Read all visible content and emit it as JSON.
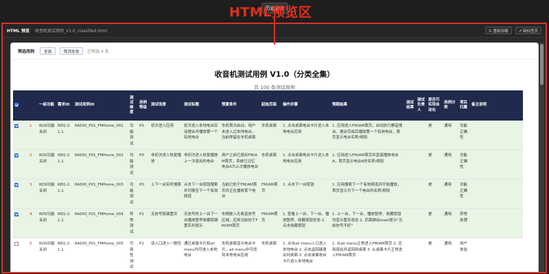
{
  "top": {
    "history_button": "历史记录"
  },
  "preview": {
    "title": "HTML 预览",
    "filename": "收音机测试用例_V1.0_classified.html",
    "reload_button": "↻ 重新加载",
    "new_tab_button": "↗ 新标签页",
    "overlay_title": "HTML预览区"
  },
  "toolbar": {
    "label": "筛选用例",
    "select_all": "全选",
    "deselect_all": "取消全选",
    "status": "已筛选 4 条"
  },
  "doc": {
    "title": "收音机测试用例 V1.0（分类全集）",
    "subtitle": "共 100 条测试用例"
  },
  "table": {
    "headers": [
      "",
      "",
      "一级功能",
      "需求ID",
      "测试用例ID",
      "测试维度",
      "用例等级",
      "测试场景",
      "测试标题",
      "预置条件",
      "起始页面",
      "操作步骤",
      "预期结果",
      "测试结果",
      "测试负责人",
      "是否可实现自动化",
      "用例分类",
      "项目归属",
      "备注说明"
    ],
    "rows": [
      {
        "checked": true,
        "num": "1",
        "func": "RDS功能关闭",
        "req": "REQ-2.1.1",
        "id": "RADIO_P01_FMHome_001",
        "dim": "功能测试",
        "level": "P0",
        "scene": "初次进入应用",
        "title": "初次进入本地电台后动搜台并播放第一个有效电台",
        "pre": "车机首次启动，用户未进入过本地电台，当前停留在车机桌面",
        "start": "车机桌面",
        "steps": "1. 点击桌面电台卡片进入本地电台应用",
        "expect": "1. 应用进入FM/AM首页，自动执行静音搜台，搜台完成后播放第一个有效电台，首页显示电台名称/频段",
        "result": "",
        "owner": "",
        "auto": "是",
        "cat": "通用",
        "proj": "功能正确性",
        "note": ""
      },
      {
        "checked": true,
        "num": "2",
        "func": "RDS功能关闭",
        "req": "REQ-2.1.1",
        "id": "RADIO_P01_FMHome_002",
        "dim": "功能测试",
        "level": "P0",
        "scene": "非初次进入恢复播放",
        "title": "非初次进入恢复播放上一次退出的电台",
        "pre": "用户之前已退出FM/AM首页，系统已记忆电台A为上次播放电台",
        "start": "车机桌面",
        "steps": "1. 点击桌面电台卡片进入本地电台应用",
        "expect": "1. 应用进入FM/AM首页并直接播放电台A，首页显示电台A的名称/频段",
        "result": "",
        "owner": "",
        "auto": "是",
        "cat": "通用",
        "proj": "功能正确性",
        "note": ""
      },
      {
        "checked": true,
        "num": "3",
        "func": "RDS功能关闭",
        "req": "REQ-2.1.1",
        "id": "RADIO_P01_FMHome_003",
        "dim": "功能测试",
        "level": "P0",
        "scene": "上下一台实时搜索",
        "title": "点击下一台按钮搜索并切换至下一个有效频道",
        "pre": "当前已处于FM/AM首页并正在播放某个电台",
        "start": "FM/AM首页",
        "steps": "1. 点击下一台按钮",
        "expect": "1. 应用搜索下一个有效频道并开始播放，首页显示为下一个电台的名称/频段",
        "result": "",
        "owner": "",
        "auto": "是",
        "cat": "通用",
        "proj": "功能正确性",
        "note": ""
      },
      {
        "checked": true,
        "num": "4",
        "func": "RDS功能关闭",
        "req": "REQ-2.1.1",
        "id": "RADIO_P01_FMHome_004",
        "dim": "异常测试",
        "level": "P1",
        "scene": "无信号按键置灰",
        "title": "无信号时上一台下一台播放暂停收藏按键置灰并提示",
        "pre": "车辆驶入无收音信号区域，应用当前处于FM/AM首页",
        "start": "FM/AM首页",
        "steps": "1. 查看上一台、下一台、播放暂停、收藏按钮状态 2. 点击收藏按钮",
        "expect": "1. 上一台、下一台、播放暂停、收藏按钮均显示置灰状态 2. 页面弹出toast提示\"当前信号不好\"",
        "result": "",
        "owner": "",
        "auto": "是",
        "cat": "通用",
        "proj": "异常处理",
        "note": ""
      },
      {
        "checked": false,
        "num": "5",
        "func": "RDS功能关闭",
        "req": "REQ-2.1.1",
        "id": "RADIO_P01_FMHome_005",
        "dim": "可用性测试",
        "level": "P1",
        "scene": "双入口进入一致性",
        "title": "通过桌面卡片和all menu均可进入本地电台",
        "pre": "车机桌面显示电台卡片，all menu中可找到本地电台应用",
        "start": "车机桌面",
        "steps": "1. 点击all menu入口进入本地电台 2. 点击返回键退出到桌面 3. 点击桌面电台卡片进入本地电台",
        "expect": "1. 从all menu正常进入FM/AM首页 2. 应用退出并返回到桌面 3. 从桌面卡片正常进入FM/AM首页",
        "result": "",
        "owner": "",
        "auto": "是",
        "cat": "通用",
        "proj": "用户体验",
        "note": ""
      }
    ]
  }
}
